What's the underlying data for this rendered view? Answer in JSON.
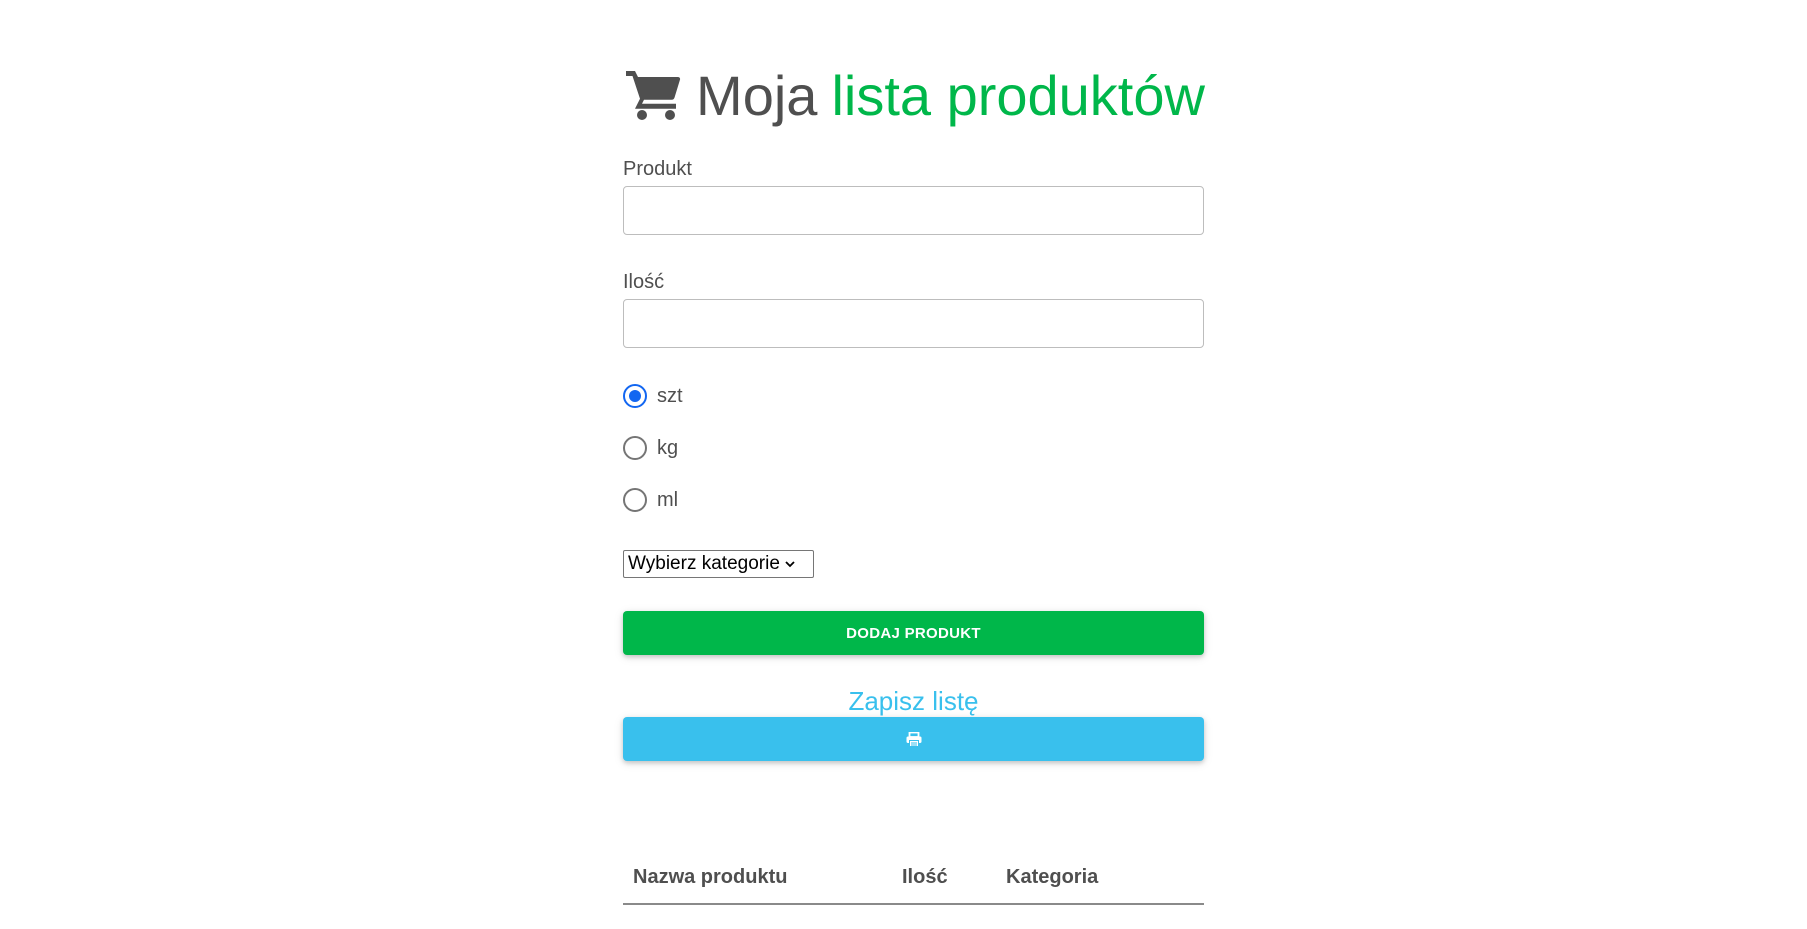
{
  "header": {
    "title_plain": "Moja",
    "title_accent": "lista produktów",
    "icon": "shopping-cart-icon",
    "accent_color": "#00b74a"
  },
  "form": {
    "product_label": "Produkt",
    "product_value": "",
    "quantity_label": "Ilość",
    "quantity_value": "",
    "units": [
      {
        "label": "szt",
        "checked": true
      },
      {
        "label": "kg",
        "checked": false
      },
      {
        "label": "ml",
        "checked": false
      }
    ],
    "category_select": "Wybierz kategorie",
    "add_button": "DODAJ PRODUKT",
    "add_button_color": "#00b74a",
    "save_link": "Zapisz listę",
    "print_button_icon": "print-icon",
    "print_button_color": "#39c0ed"
  },
  "table": {
    "columns": [
      "Nazwa produktu",
      "Ilość",
      "Kategoria"
    ],
    "rows": []
  }
}
